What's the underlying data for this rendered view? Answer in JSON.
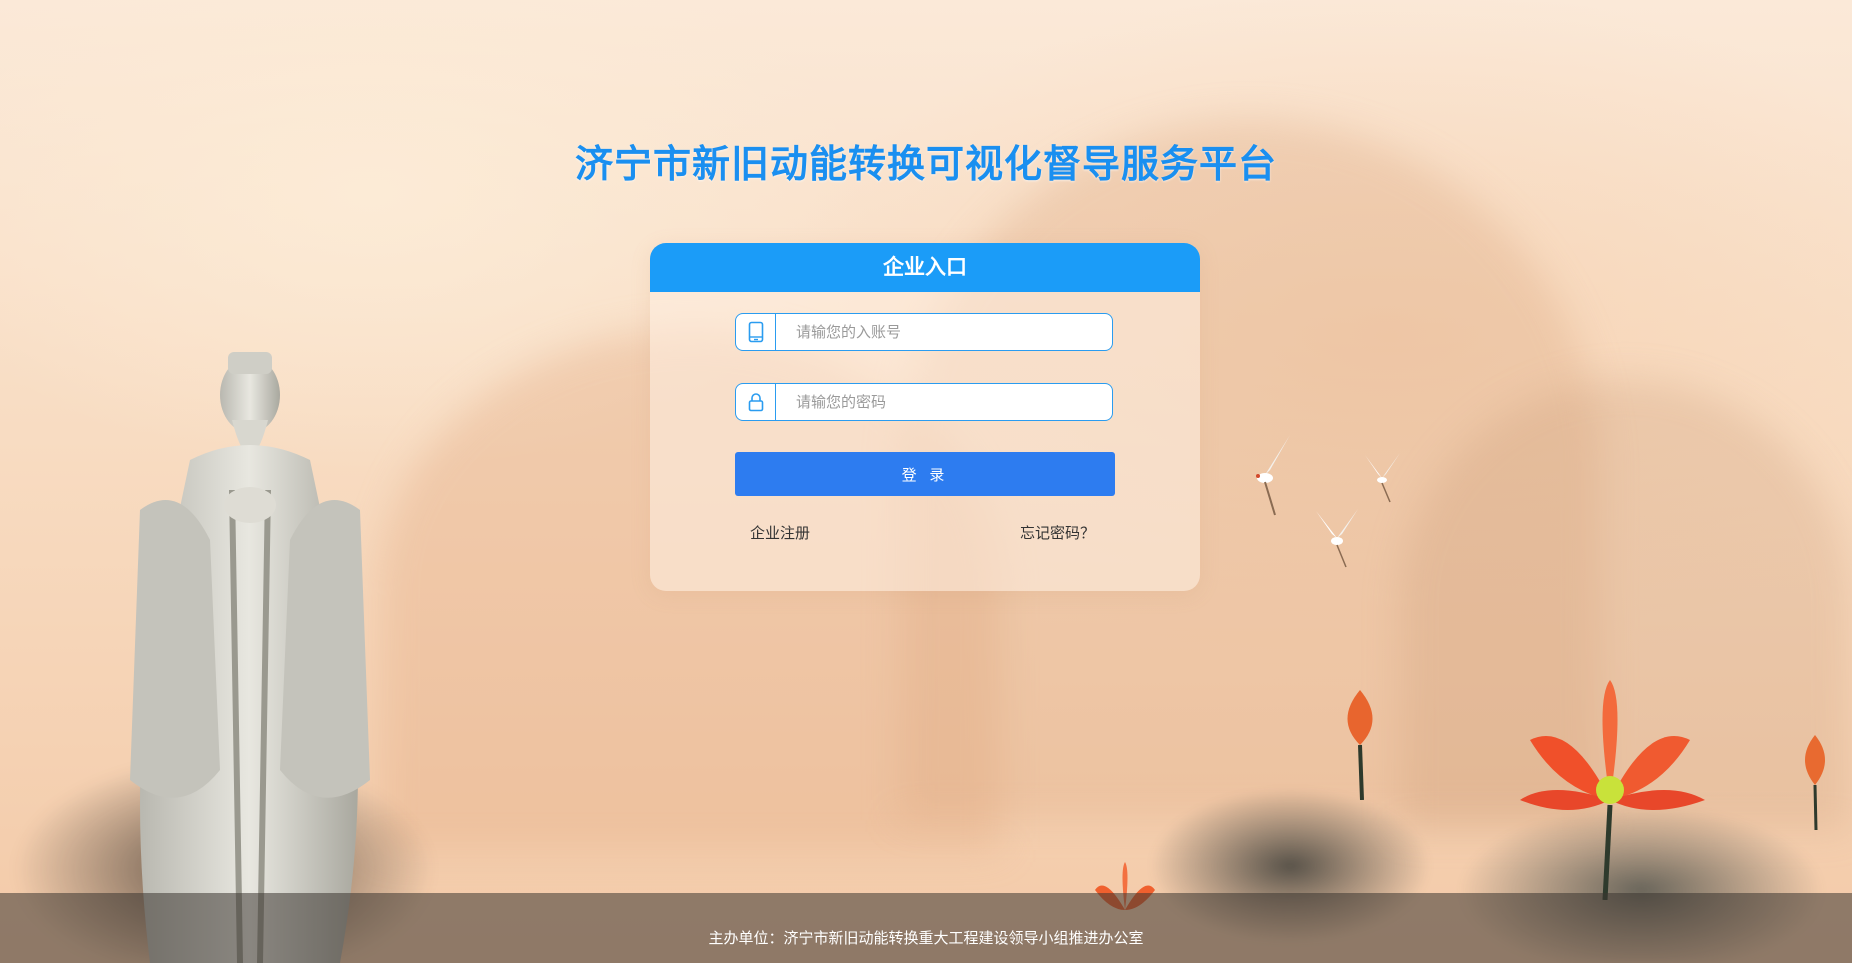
{
  "page": {
    "title": "济宁市新旧动能转换可视化督导服务平台"
  },
  "login_card": {
    "header": "企业入口",
    "account_placeholder": "请输您的入账号",
    "password_placeholder": "请输您的密码",
    "login_label": "登 录",
    "register_link": "企业注册",
    "forgot_link": "忘记密码？"
  },
  "footer": {
    "text": "主办单位：济宁市新旧动能转换重大工程建设领导小组推进办公室"
  },
  "icons": {
    "account": "phone-icon",
    "password": "lock-icon"
  },
  "colors": {
    "accent": "#1b9cf8",
    "button": "#2d7cf0",
    "title": "#1a8ff0"
  }
}
